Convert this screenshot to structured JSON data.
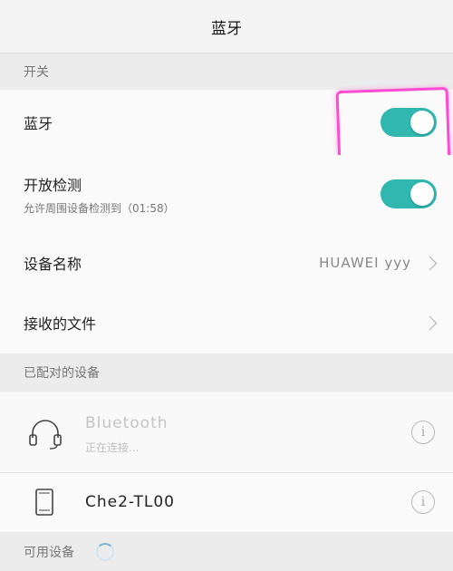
{
  "header": {
    "title": "蓝牙"
  },
  "switch_section": {
    "label": "开关"
  },
  "bluetooth": {
    "label": "蓝牙",
    "enabled": true
  },
  "visibility": {
    "label": "开放检测",
    "subtitle": "允许周围设备检测到（01:58）",
    "enabled": true
  },
  "device_name": {
    "label": "设备名称",
    "value": "HUAWEI yyy"
  },
  "received_files": {
    "label": "接收的文件"
  },
  "paired_section": {
    "label": "已配对的设备"
  },
  "paired_devices": [
    {
      "name": "Bluetooth",
      "status": "正在连接...",
      "icon": "headset-icon"
    },
    {
      "name": "Che2-TL00",
      "status": "",
      "icon": "phone-icon"
    }
  ],
  "available_section": {
    "label": "可用设备"
  },
  "colors": {
    "accent": "#2fb7b0",
    "highlight": "#ff4bd2"
  }
}
